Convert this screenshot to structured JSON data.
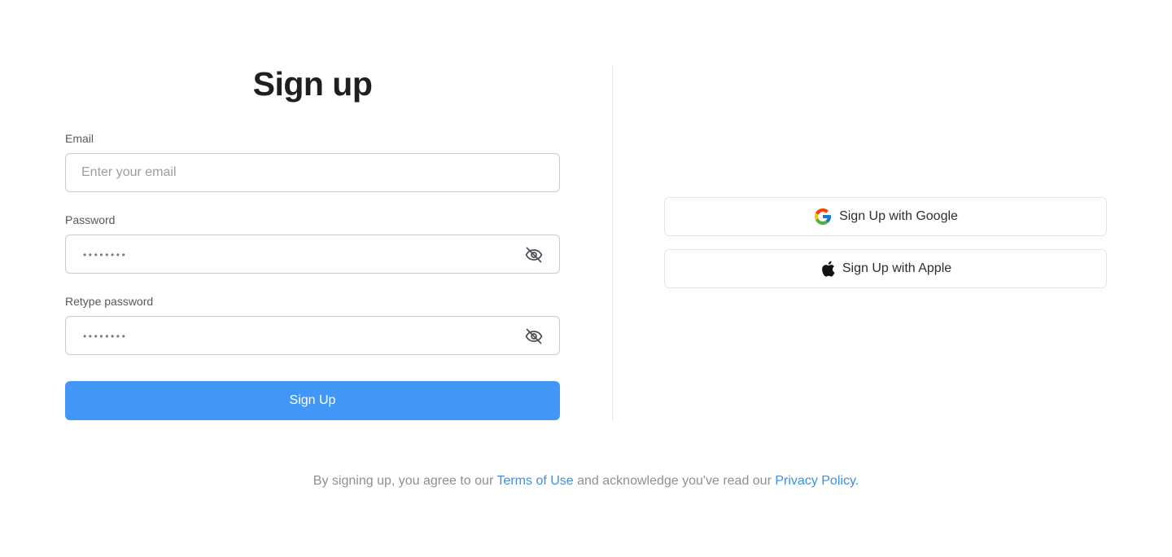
{
  "form": {
    "title": "Sign up",
    "email": {
      "label": "Email",
      "placeholder": "Enter your email",
      "value": ""
    },
    "password": {
      "label": "Password",
      "masked_value": "••••••••",
      "toggle_icon": "eye-off-icon"
    },
    "retype_password": {
      "label": "Retype password",
      "masked_value": "••••••••",
      "toggle_icon": "eye-off-icon"
    },
    "submit_label": "Sign Up"
  },
  "social": {
    "google_label": "Sign Up with Google",
    "google_icon": "google-icon",
    "apple_label": "Sign Up with Apple",
    "apple_icon": "apple-icon"
  },
  "footer": {
    "text_before": "By signing up, you agree to our ",
    "terms_link": "Terms of Use",
    "text_middle": " and acknowledge you've read our ",
    "privacy_link": "Privacy Policy."
  },
  "colors": {
    "primary": "#4297f6",
    "link": "#3e8fe0",
    "input_border": "#c8cbd0",
    "divider": "#e6e8eb"
  }
}
